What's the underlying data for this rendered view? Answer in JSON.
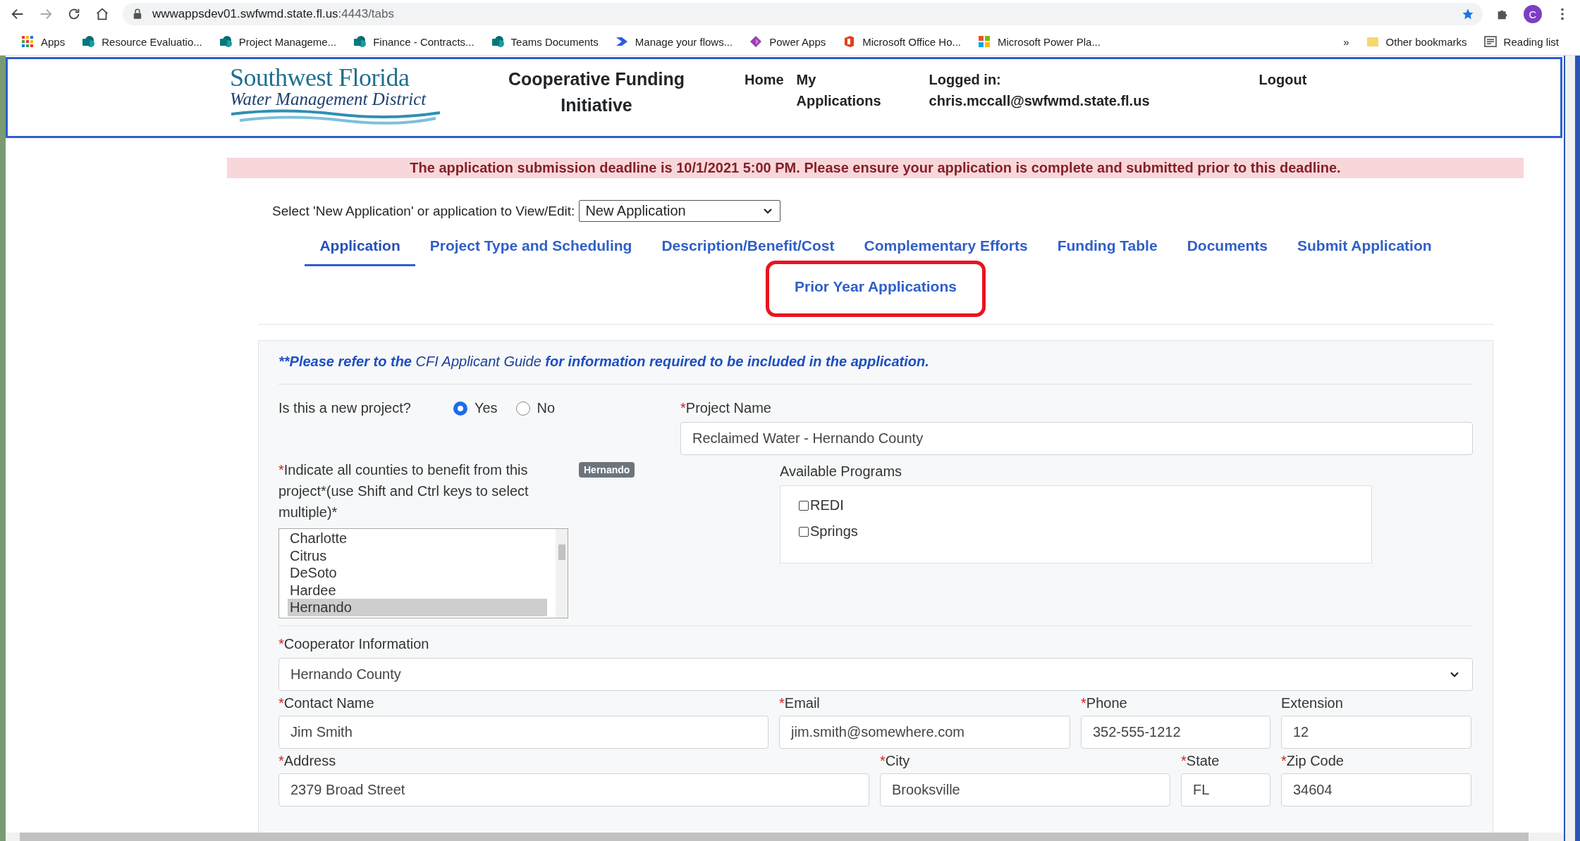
{
  "browser": {
    "url_host": "wwwappsdev01.swfwmd.state.fl.us",
    "url_path": ":4443/tabs",
    "profile_initial": "C",
    "bookmarks": [
      {
        "label": "Apps",
        "kind": "apps"
      },
      {
        "label": "Resource Evaluatio...",
        "kind": "sharepoint"
      },
      {
        "label": "Project Manageme...",
        "kind": "sharepoint"
      },
      {
        "label": "Finance - Contracts...",
        "kind": "sharepoint"
      },
      {
        "label": "Teams Documents",
        "kind": "sharepoint"
      },
      {
        "label": "Manage your flows...",
        "kind": "flow"
      },
      {
        "label": "Power Apps",
        "kind": "powerapps"
      },
      {
        "label": "Microsoft Office Ho...",
        "kind": "office"
      },
      {
        "label": "Microsoft Power Pla...",
        "kind": "windows"
      }
    ],
    "overflow": "»",
    "other_bookmarks": "Other bookmarks",
    "reading_list": "Reading list"
  },
  "header": {
    "logo_lines": [
      "Southwest Florida",
      "Water Management District"
    ],
    "title": "Cooperative Funding Initiative",
    "nav": [
      "Home",
      "My Applications"
    ],
    "logged_in_label": "Logged in:",
    "user_email": "chris.mccall@swfwmd.state.fl.us",
    "logout": "Logout"
  },
  "banner": "The application submission deadline is 10/1/2021 5:00 PM. Please ensure your application is complete and submitted prior to this deadline.",
  "selector": {
    "label": "Select 'New Application' or application to View/Edit:",
    "value": "New Application"
  },
  "tabs": [
    {
      "label": "Application",
      "selected": true,
      "highlighted": false
    },
    {
      "label": "Project Type and Scheduling",
      "selected": false,
      "highlighted": false
    },
    {
      "label": "Description/Benefit/Cost",
      "selected": false,
      "highlighted": false
    },
    {
      "label": "Complementary Efforts",
      "selected": false,
      "highlighted": false
    },
    {
      "label": "Funding Table",
      "selected": false,
      "highlighted": false
    },
    {
      "label": "Documents",
      "selected": false,
      "highlighted": false
    },
    {
      "label": "Submit Application",
      "selected": false,
      "highlighted": false
    },
    {
      "label": "Prior Year Applications",
      "selected": false,
      "highlighted": true
    }
  ],
  "form": {
    "guide_note": {
      "before": "**Please refer to the",
      "link": "CFI Applicant Guide",
      "after": "for information required to be included in the application."
    },
    "new_project": {
      "label": "Is this a new project?",
      "options": [
        {
          "label": "Yes",
          "selected": true
        },
        {
          "label": "No",
          "selected": false
        }
      ]
    },
    "project_name": {
      "required_mark": "*",
      "label": "Project Name",
      "value": "Reclaimed Water - Hernando County"
    },
    "counties": {
      "required_mark": "*",
      "label": "Indicate all counties to benefit from this project*(use Shift and Ctrl keys to select multiple)*",
      "badge": "Hernando",
      "items": [
        {
          "label": "Charlotte",
          "selected": false
        },
        {
          "label": "Citrus",
          "selected": false
        },
        {
          "label": "DeSoto",
          "selected": false
        },
        {
          "label": "Hardee",
          "selected": false
        },
        {
          "label": "Hernando",
          "selected": true
        }
      ]
    },
    "programs": {
      "label": "Available Programs",
      "items": [
        {
          "label": "REDI",
          "checked": false
        },
        {
          "label": "Springs",
          "checked": false
        }
      ]
    },
    "cooperator": {
      "required_mark": "*",
      "label": "Cooperator Information",
      "value": "Hernando County"
    },
    "field_rows": [
      [
        {
          "required_mark": "*",
          "label": "Contact Name",
          "value": "Jim Smith",
          "kind": "contact"
        },
        {
          "required_mark": "*",
          "label": "Email",
          "value": "jim.smith@somewhere.com",
          "kind": "email"
        },
        {
          "required_mark": "*",
          "label": "Phone",
          "value": "352-555-1212",
          "kind": "phone"
        },
        {
          "label": "Extension",
          "value": "12",
          "kind": "ext"
        }
      ],
      [
        {
          "required_mark": "*",
          "label": "Address",
          "value": "2379 Broad Street",
          "kind": "address"
        },
        {
          "required_mark": "*",
          "label": "City",
          "value": "Brooksville",
          "kind": "city"
        },
        {
          "required_mark": "*",
          "label": "State",
          "value": "FL",
          "kind": "state"
        },
        {
          "required_mark": "*",
          "label": "Zip Code",
          "value": "34604",
          "kind": "zip"
        }
      ]
    ]
  }
}
